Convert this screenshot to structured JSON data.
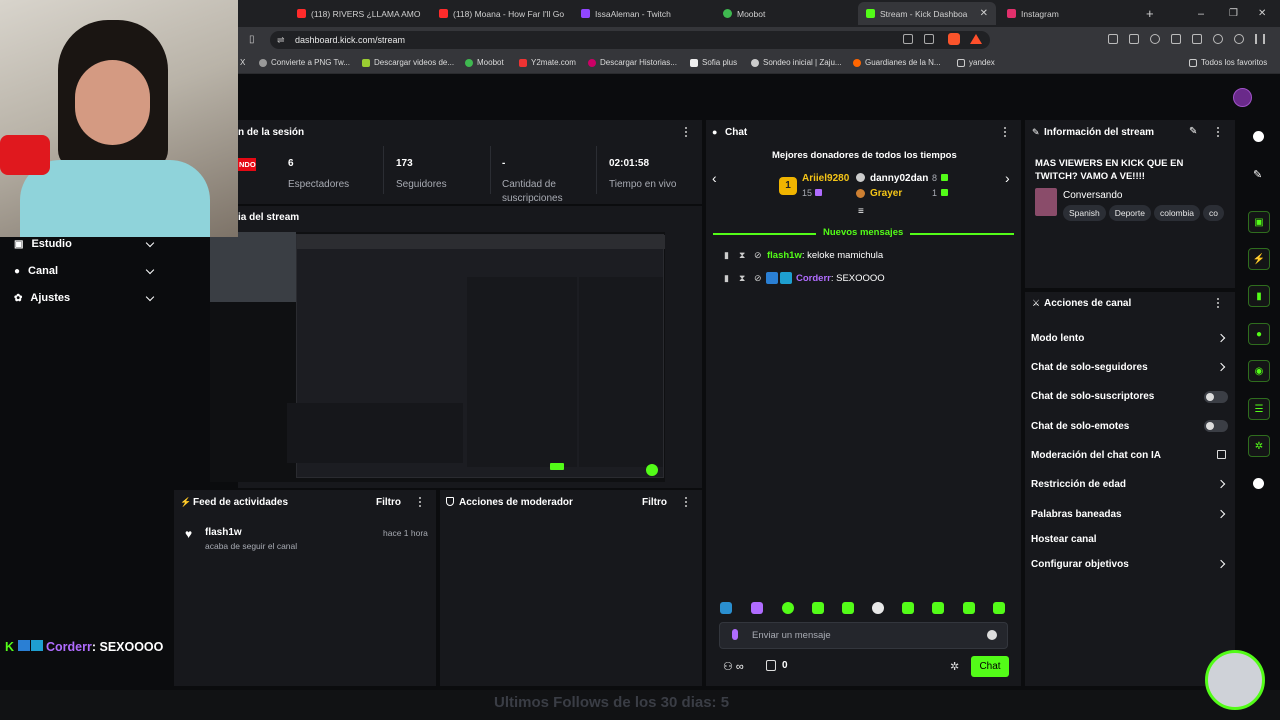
{
  "browser": {
    "tabs": [
      {
        "label": "(118) RIVERS ¿LLAMA AMO",
        "color": "#ff2b2b"
      },
      {
        "label": "(118) Moana - How Far I'll Go",
        "color": "#ff2b2b"
      },
      {
        "label": "IssaAleman - Twitch",
        "color": "#9146ff"
      },
      {
        "label": "Moobot",
        "color": "#3fb950"
      },
      {
        "label": "Stream - Kick Dashboa",
        "color": "#53fc18"
      },
      {
        "label": "Instagram",
        "color": "#e1306c"
      }
    ],
    "url": "dashboard.kick.com/stream",
    "bookmarks": [
      "Convierte a PNG Tw...",
      "Descargar videos de...",
      "Moobot",
      "Y2mate.com",
      "Descargar Historias...",
      "Sofia plus",
      "Sondeo inicial | Zaju...",
      "Guardianes de la N...",
      "yandex"
    ],
    "bookmarks_x": "X",
    "all_favorites": "Todos los favoritos"
  },
  "session": {
    "title": "n de la sesión",
    "live_badge": "NDO",
    "stats": [
      {
        "value": "6",
        "label": "Espectadores"
      },
      {
        "value": "173",
        "label": "Seguidores"
      },
      {
        "value": "-",
        "label": "Cantidad de suscripciones"
      },
      {
        "value": "02:01:58",
        "label": "Tiempo en vivo"
      }
    ]
  },
  "preview": {
    "title": "ia del stream"
  },
  "sidebar": {
    "items": [
      {
        "label": "Estudio"
      },
      {
        "label": "Canal"
      },
      {
        "label": "Ajustes"
      }
    ]
  },
  "feed": {
    "title": "Feed de actividades",
    "filter": "Filtro",
    "item": {
      "user": "flash1w",
      "text": "acaba de seguir el canal",
      "time": "hace 1 hora"
    }
  },
  "modactions": {
    "title": "Acciones de moderador",
    "filter": "Filtro"
  },
  "chat": {
    "title": "Chat",
    "top_donors_title": "Mejores donadores de todos los tiempos",
    "donor1": {
      "name": "Ariiel9280",
      "rank": "1",
      "amount": "15"
    },
    "donor2": {
      "name": "danny02dan",
      "amount": "8"
    },
    "donor3": {
      "name": "Grayer",
      "amount": "1"
    },
    "new_messages": "Nuevos mensajes",
    "messages": [
      {
        "user": "flash1w",
        "text": "keloke mamichula",
        "color": "#53fc18"
      },
      {
        "user": "Corderr",
        "text": "SEXOOOO",
        "color": "#b06cff"
      }
    ],
    "input_placeholder": "Enviar un mensaje",
    "points": "0",
    "send_label": "Chat"
  },
  "info": {
    "title": "Información del stream",
    "stream_title": "MAS VIEWERS EN KICK QUE EN TWITCH? VAMO A VE!!!!",
    "category": "Conversando",
    "tags": [
      "Spanish",
      "Deporte",
      "colombia",
      "co"
    ]
  },
  "channel_actions": {
    "title": "Acciones de canal",
    "rows": [
      {
        "label": "Modo lento",
        "type": "chevron"
      },
      {
        "label": "Chat de solo-seguidores",
        "type": "chevron"
      },
      {
        "label": "Chat de solo-suscriptores",
        "type": "toggle"
      },
      {
        "label": "Chat de solo-emotes",
        "type": "toggle"
      },
      {
        "label": "Moderación del chat con IA",
        "type": "external"
      },
      {
        "label": "Restricción de edad",
        "type": "chevron"
      },
      {
        "label": "Palabras baneadas",
        "type": "chevron"
      },
      {
        "label": "Hostear canal",
        "type": "none"
      },
      {
        "label": "Configurar objetivos",
        "type": "chevron"
      }
    ]
  },
  "overlay": {
    "chat_line_user": "Corderr",
    "chat_line_text": ": SEXOOOO",
    "follows_text": "Ultimos Follows de los 30 dias: 5"
  },
  "colors": {
    "accent": "#53fc18",
    "panel": "#17181c",
    "bg": "#0b0c0e"
  }
}
